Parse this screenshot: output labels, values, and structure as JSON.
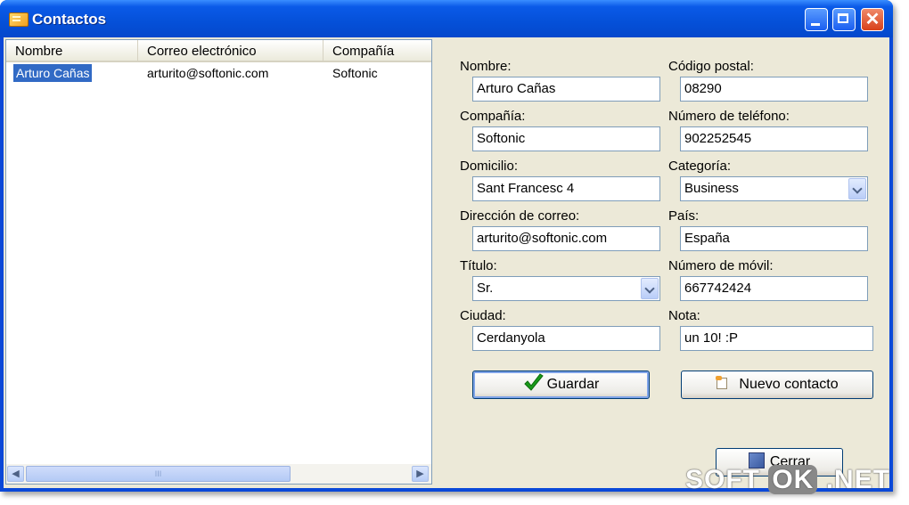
{
  "window": {
    "title": "Contactos"
  },
  "list": {
    "columns": [
      "Nombre",
      "Correo electrónico",
      "Compañía"
    ],
    "rows": [
      {
        "name": "Arturo Cañas",
        "email": "arturito@softonic.com",
        "company": "Softonic"
      }
    ],
    "scroll_thumb_glyph": "III"
  },
  "form": {
    "nombre": {
      "label": "Nombre:",
      "value": "Arturo Cañas"
    },
    "compania": {
      "label": "Compañía:",
      "value": "Softonic"
    },
    "domicilio": {
      "label": "Domicilio:",
      "value": "Sant Francesc 4"
    },
    "direccion_correo": {
      "label": "Dirección de correo:",
      "value": "arturito@softonic.com"
    },
    "titulo": {
      "label": "Título:",
      "value": "Sr."
    },
    "ciudad": {
      "label": "Ciudad:",
      "value": "Cerdanyola"
    },
    "codigo_postal": {
      "label": "Código postal:",
      "value": "08290"
    },
    "telefono": {
      "label": "Número de teléfono:",
      "value": "902252545"
    },
    "categoria": {
      "label": "Categoría:",
      "value": "Business"
    },
    "pais": {
      "label": "País:",
      "value": "España"
    },
    "movil": {
      "label": "Número de móvil:",
      "value": "667742424"
    },
    "nota": {
      "label": "Nota:",
      "value": "un 10! :P"
    }
  },
  "buttons": {
    "guardar": "Guardar",
    "nuevo_contacto": "Nuevo contacto",
    "cerrar": "Cerrar"
  },
  "watermark": {
    "left": "SOFT",
    "middle": "OK",
    "right": ".NET"
  },
  "colors": {
    "title_bar": "#0550d8",
    "selection": "#316ac5",
    "face": "#ece9d8",
    "check": "#1a9a1a"
  }
}
